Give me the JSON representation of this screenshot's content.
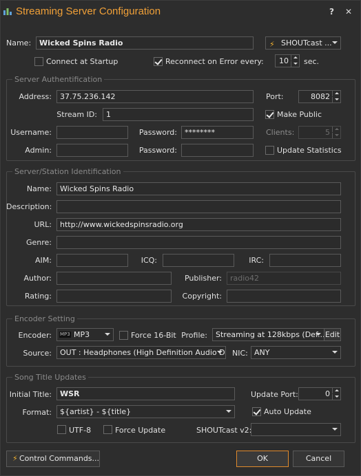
{
  "window": {
    "title": "Streaming Server Configuration",
    "help": "?",
    "close": "✕"
  },
  "top": {
    "name_label": "Name:",
    "name_value": "Wicked Spins Radio",
    "server_type": "SHOUTcast ...",
    "connect_label": "Connect at Startup",
    "connect_checked": false,
    "reconnect_label": "Reconnect on Error every:",
    "reconnect_checked": true,
    "reconnect_value": "10",
    "sec_label": "sec."
  },
  "auth": {
    "group_title": "Server Authentification",
    "address_label": "Address:",
    "address_value": "37.75.236.142",
    "port_label": "Port:",
    "port_value": "8082",
    "stream_id_label": "Stream ID:",
    "stream_id_value": "1",
    "make_public_label": "Make Public",
    "make_public_checked": true,
    "username_label": "Username:",
    "username_value": "",
    "password_label": "Password:",
    "password_value": "********",
    "clients_label": "Clients:",
    "clients_value": "5",
    "admin_label": "Admin:",
    "admin_value": "",
    "password2_label": "Password:",
    "password2_value": "",
    "update_stats_label": "Update Statistics",
    "update_stats_checked": false
  },
  "ident": {
    "group_title": "Server/Station Identification",
    "name_label": "Name:",
    "name_value": "Wicked Spins Radio",
    "description_label": "Description:",
    "description_value": "",
    "url_label": "URL:",
    "url_value": "http://www.wickedspinsradio.org",
    "genre_label": "Genre:",
    "genre_value": "",
    "aim_label": "AIM:",
    "aim_value": "",
    "icq_label": "ICQ:",
    "icq_value": "",
    "irc_label": "IRC:",
    "irc_value": "",
    "author_label": "Author:",
    "author_value": "",
    "publisher_label": "Publisher:",
    "publisher_value": "radio42",
    "rating_label": "Rating:",
    "rating_value": "",
    "copyright_label": "Copyright:",
    "copyright_value": ""
  },
  "encoder": {
    "group_title": "Encoder Setting",
    "encoder_label": "Encoder:",
    "encoder_value": "MP3",
    "encoder_badge": "MP3",
    "force16_label": "Force 16-Bit",
    "force16_checked": false,
    "profile_label": "Profile:",
    "profile_value": "Streaming at 128kbps (Def...",
    "edit_label": "Edit",
    "source_label": "Source:",
    "source_value": "OUT  : Headphones (High Definition Audio D...",
    "nic_label": "NIC:",
    "nic_value": "ANY"
  },
  "song": {
    "group_title": "Song Title Updates",
    "initial_title_label": "Initial Title:",
    "initial_title_value": "WSR",
    "update_port_label": "Update Port:",
    "update_port_value": "0",
    "format_label": "Format:",
    "format_value": "${artist} - ${title}",
    "auto_update_label": "Auto Update",
    "auto_update_checked": true,
    "utf8_label": "UTF-8",
    "utf8_checked": false,
    "force_update_label": "Force Update",
    "force_update_checked": false,
    "shoutcast_v2_label": "SHOUTcast v2:",
    "shoutcast_v2_value": ""
  },
  "footer": {
    "control_commands": "Control Commands...",
    "ok": "OK",
    "cancel": "Cancel"
  },
  "colors": {
    "accent": "#f0a038",
    "background": "#2d2d2d",
    "ok_border": "#e08a2c"
  }
}
